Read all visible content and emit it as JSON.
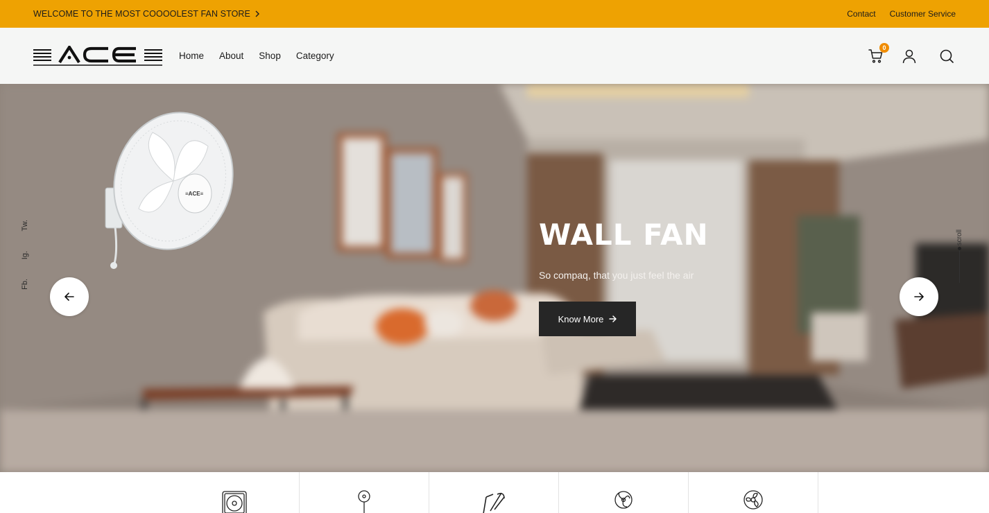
{
  "announcement": {
    "text": "WELCOME TO THE MOST COOOOLEST FAN STORE",
    "contact": "Contact",
    "customer_service": "Customer Service"
  },
  "header": {
    "brand": "ACE",
    "nav": [
      "Home",
      "About",
      "Shop",
      "Category"
    ],
    "cart_count": "0",
    "icons": [
      "cart-icon",
      "user-icon",
      "search-icon"
    ]
  },
  "hero": {
    "title": "WALL FAN",
    "subtitle": "So compaq, that you just feel the air",
    "cta_label": "Know More",
    "socials": [
      "Tw.",
      "Ig.",
      "Fb."
    ],
    "scroll_label": "scroll"
  },
  "categories": {
    "icons": [
      "exhaust-fan-icon",
      "pedestal-fan-icon",
      "ceiling-fan-icon",
      "table-fan-icon",
      "wall-fan-icon"
    ]
  },
  "colors": {
    "accent": "#eea202",
    "header_bg": "#f5f6f5",
    "button_dark": "#262626",
    "badge": "#f08c00"
  }
}
